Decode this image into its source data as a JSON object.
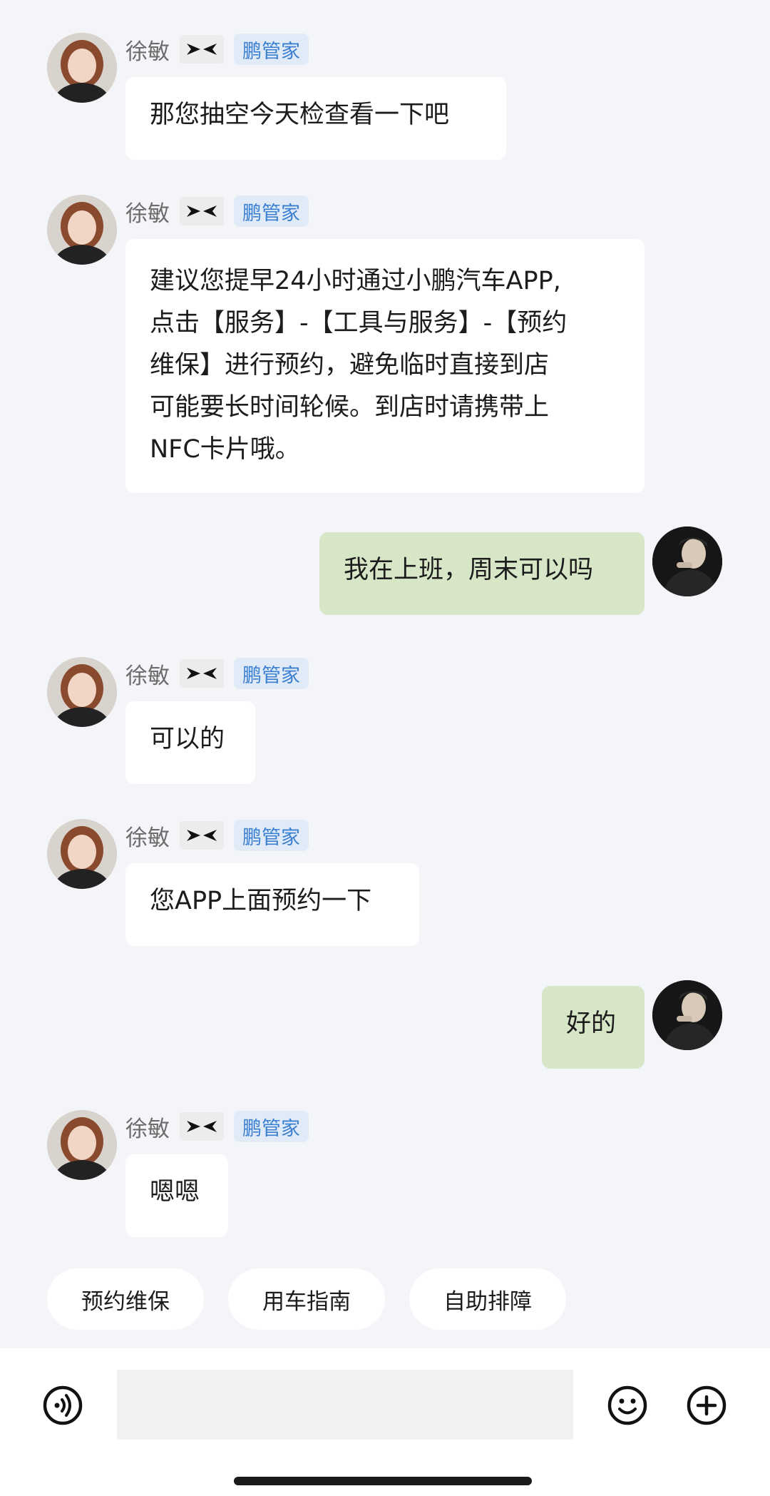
{
  "messages": [
    {
      "agent_name": "徐敏",
      "tag": "鹏管家",
      "text": "那您抽空今天检查看一下吧"
    },
    {
      "agent_name": "徐敏",
      "tag": "鹏管家",
      "text": "建议您提早24小时通过小鹏汽车APP,\n点击【服务】-【工具与服务】-【预约\n维保】进行预约，避免临时直接到店\n可能要长时间轮候。到店时请携带上\nNFC卡片哦。"
    },
    {
      "text": "我在上班，周末可以吗"
    },
    {
      "agent_name": "徐敏",
      "tag": "鹏管家",
      "text": "可以的"
    },
    {
      "agent_name": "徐敏",
      "tag": "鹏管家",
      "text": "您APP上面预约一下"
    },
    {
      "text": "好的"
    },
    {
      "agent_name": "徐敏",
      "tag": "鹏管家",
      "text": "嗯嗯"
    }
  ],
  "quick_replies": [
    "预约维保",
    "用车指南",
    "自助排障"
  ],
  "input": {
    "value": "",
    "placeholder": ""
  },
  "icons": {
    "voice": "voice-icon",
    "emoji": "emoji-icon",
    "more": "add-circle-icon",
    "brand": "xpeng-logo-icon"
  },
  "colors": {
    "background": "#f4f5f9",
    "incoming_bubble": "#ffffff",
    "outgoing_bubble": "#d8e6c8",
    "tag_bg": "#e1ebf8",
    "tag_text": "#3a7fd0"
  }
}
